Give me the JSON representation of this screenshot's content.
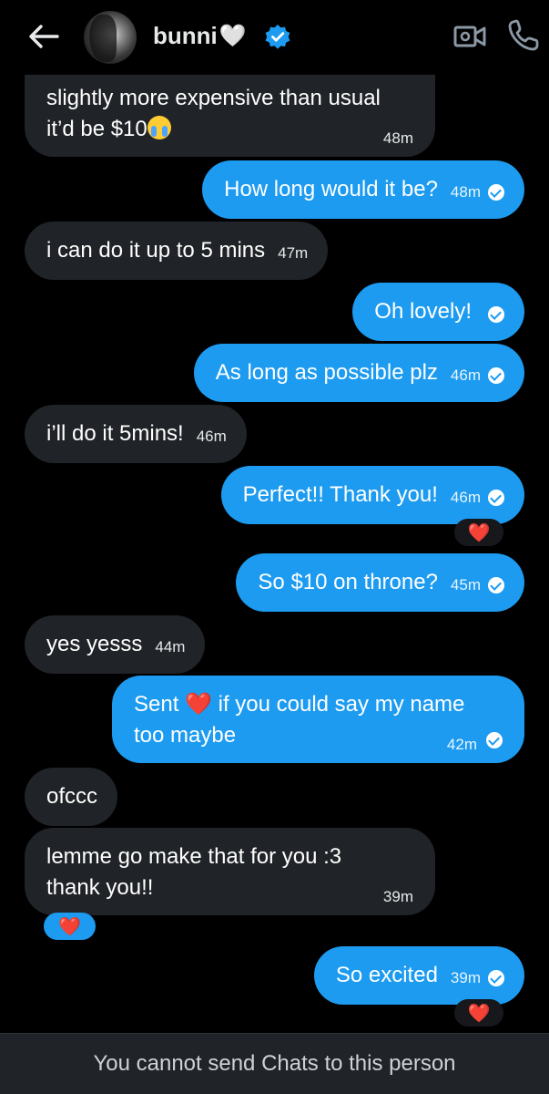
{
  "header": {
    "back_label": "Back",
    "name": "bunni",
    "name_suffix": "🤍",
    "verified": true,
    "icons": [
      "back-arrow-icon",
      "avatar",
      "verified-badge-icon",
      "video-call-icon",
      "phone-icon"
    ]
  },
  "messages": [
    {
      "dir": "in",
      "lines": [
        "slightly more expensive than usual",
        "it’d be $10"
      ],
      "emoji": "crying-face",
      "time": "48m"
    },
    {
      "dir": "out",
      "text": "How long would it be?",
      "time": "48m"
    },
    {
      "dir": "in",
      "text": "i can do it up to 5 mins",
      "time": "47m"
    },
    {
      "dir": "out",
      "text": "Oh lovely!",
      "time": ""
    },
    {
      "dir": "out",
      "text": "As long as possible plz",
      "time": "46m"
    },
    {
      "dir": "in",
      "text": "i’ll do it 5mins!",
      "time": "46m"
    },
    {
      "dir": "out",
      "text": "Perfect!! Thank you!",
      "time": "46m",
      "reaction": "❤️"
    },
    {
      "dir": "out",
      "text": "So $10 on throne?",
      "time": "45m"
    },
    {
      "dir": "in",
      "text": "yes yesss",
      "time": "44m"
    },
    {
      "dir": "out",
      "lines_prefix": "Sent",
      "line1_rest": "if you could say my name",
      "line2": "too maybe",
      "time": "42m"
    },
    {
      "dir": "in",
      "text": "ofccc",
      "time": ""
    },
    {
      "dir": "in",
      "lines": [
        "lemme go make that for you :3",
        "thank you!!"
      ],
      "time": "39m",
      "reaction": "❤️"
    },
    {
      "dir": "out",
      "text": "So excited",
      "time": "39m",
      "reaction": "❤️"
    }
  ],
  "heart": "❤️",
  "footer": {
    "notice": "You cannot send Chats to this person"
  },
  "colors": {
    "background": "#000000",
    "incoming_bubble": "#202327",
    "outgoing_bubble": "#1d9bf0",
    "reaction_heart": "#f4212e",
    "footer_bg": "#202327"
  }
}
